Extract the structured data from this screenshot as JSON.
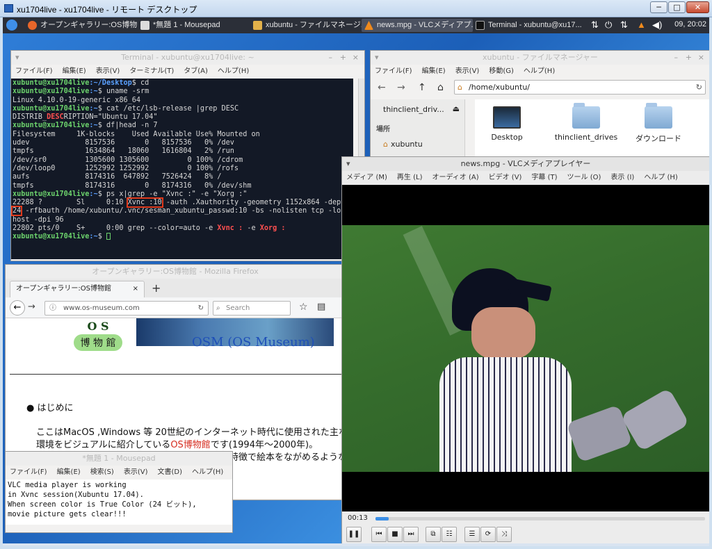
{
  "rdp": {
    "title": "xu1704live - xu1704live - リモート デスクトップ",
    "minimize": "─",
    "maximize": "□",
    "close": "✕"
  },
  "panel": {
    "tasks": [
      {
        "label": "オープンギャラリー:OS博物..."
      },
      {
        "label": "*無題 1 - Mousepad"
      },
      {
        "label": "xubuntu - ファイルマネージ..."
      },
      {
        "label": "news.mpg - VLCメディアプ..."
      },
      {
        "label": "Terminal - xubuntu@xu17..."
      }
    ],
    "clock": "09, 20:02"
  },
  "terminal": {
    "title": "Terminal - xubuntu@xu1704live: ~",
    "menu": [
      "ファイル(F)",
      "編集(E)",
      "表示(V)",
      "ターミナル(T)",
      "タブ(A)",
      "ヘルプ(H)"
    ],
    "lines": {
      "prompt_user": "xubuntu@xu1704live",
      "p1_path": ":~/Desktop",
      "p1_cmd": "$ cd",
      "p2_cmd": "$ uname -srm",
      "uname": "Linux 4.10.0-19-generic x86_64",
      "p3_cmd": "$ cat /etc/lsb-release |grep DESC",
      "lsb_a": "DISTRIB_",
      "lsb_b": "DESC",
      "lsb_c": "RIPTION=\"Ubuntu 17.04\"",
      "p4_cmd": "$ df|head -n 7",
      "df_header": "Filesystem     1K-blocks    Used Available Use% Mounted on",
      "df1": "udev             8157536       0   8157536   0% /dev",
      "df2": "tmpfs            1634864   18060   1616804   2% /run",
      "df3": "/dev/sr0         1305600 1305600         0 100% /cdrom",
      "df4": "/dev/loop0       1252992 1252992         0 100% /rofs",
      "df5": "aufs             8174316  647892   7526424   8% /",
      "df6": "tmpfs            8174316       0   8174316   0% /dev/shm",
      "p5_cmd": "$ ps x|grep -e \"Xvnc :\" -e \"Xorg :\"",
      "ps1_a": "22288 ?        Sl     0:10 ",
      "ps1_b": "Xvnc :10",
      "ps1_c": " -auth .Xauthority -geometry 1152x864 -dept",
      "ps2_a": "24",
      "ps2_b": " -rfbauth /home/xubuntu/.vnc/sesman_xubuntu_passwd:10 -bs -nolisten tcp -lo",
      "ps3": "host -dpi 96",
      "ps4_a": "22802 pts/0    S+     0:00 grep --color=auto -e ",
      "ps4_b": "Xvnc :",
      "ps4_c": " -e ",
      "ps4_d": "Xorg :",
      "p6_path": ":~",
      "p6_cmd": "$ "
    }
  },
  "filemanager": {
    "title": "xubuntu - ファイルマネージャー",
    "menu": [
      "ファイル(F)",
      "編集(E)",
      "表示(V)",
      "移動(G)",
      "ヘルプ(H)"
    ],
    "path": "/home/xubuntu/",
    "side": {
      "drive": "thinclient_driv...",
      "section": "場所",
      "home": "xubuntu"
    },
    "icons": [
      "Desktop",
      "thinclient_drives",
      "ダウンロード"
    ]
  },
  "firefox": {
    "title": "オープンギャラリー:OS博物館 - Mozilla Firefox",
    "tab": "オープンギャラリー:OS博物館",
    "url": "www.os-museum.com",
    "search_placeholder": "Search",
    "logo_os": "O S",
    "logo_kanji": "博 物 館",
    "banner": "OSM (OS Museum)",
    "bullet": "はじめに",
    "para1": "ここはMacOS ,Windows 等 20世紀のインターネット時代に使用された主な",
    "para2a": "環境をビジュアルに紹介している",
    "para2_link": "OS博物館",
    "para2b": "です(1994年〜2000年)。",
    "para3": "特徴で絵本をながめるような"
  },
  "mousepad": {
    "title": "*無題 1 - Mousepad",
    "menu": [
      "ファイル(F)",
      "編集(E)",
      "検索(S)",
      "表示(V)",
      "文書(D)",
      "ヘルプ(H)"
    ],
    "text": "VLC media player is working\nin Xvnc session(Xubuntu 17.04).\nWhen screen color is True Color (24 ビット),\nmovie picture gets clear!!!"
  },
  "vlc": {
    "title": "news.mpg - VLCメディアプレイヤー",
    "menu": [
      "メディア (M)",
      "再生 (L)",
      "オーディオ (A)",
      "ビデオ (V)",
      "字幕 (T)",
      "ツール (O)",
      "表示 (I)",
      "ヘルプ (H)"
    ],
    "time": "00:13",
    "progress": 0.04
  },
  "colors": {
    "terminal_bg": "#131926",
    "prompt_green": "#6cd26c",
    "path_blue": "#5aa0ff",
    "grep_red": "#ff5050",
    "highlight_box": "#e03a1c",
    "link_red": "#d62d20"
  }
}
